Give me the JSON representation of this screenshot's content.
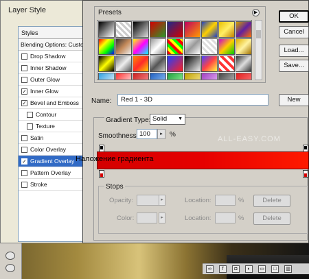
{
  "layer_style": {
    "title": "Layer Style",
    "styles_header": "Styles",
    "blending_options": "Blending Options: Custom",
    "items": [
      {
        "label": "Drop Shadow",
        "checked": false
      },
      {
        "label": "Inner Shadow",
        "checked": false
      },
      {
        "label": "Outer Glow",
        "checked": false
      },
      {
        "label": "Inner Glow",
        "checked": true
      },
      {
        "label": "Bevel and Emboss",
        "checked": true
      },
      {
        "label": "Contour",
        "checked": false
      },
      {
        "label": "Texture",
        "checked": false
      },
      {
        "label": "Satin",
        "checked": false
      },
      {
        "label": "Color Overlay",
        "checked": false
      },
      {
        "label": "Gradient Overlay",
        "checked": true
      },
      {
        "label": "Pattern Overlay",
        "checked": false
      },
      {
        "label": "Stroke",
        "checked": false
      }
    ]
  },
  "gradient_editor": {
    "presets_label": "Presets",
    "buttons": {
      "ok": "OK",
      "cancel": "Cancel",
      "load": "Load...",
      "save": "Save...",
      "new": "New"
    },
    "name_label": "Name:",
    "name_value": "Red 1 - 3D",
    "gradient_type_label": "Gradient Type:",
    "gradient_type_value": "Solid",
    "smoothness_label": "Smoothness:",
    "smoothness_value": "100",
    "smoothness_unit": "%",
    "watermark": "ALL-EASY.COM",
    "stops_label": "Stops",
    "opacity_label": "Opacity:",
    "color_label": "Color:",
    "location_label": "Location:",
    "percent": "%",
    "delete_label": "Delete"
  },
  "overlay_caption": "Наложение градиента",
  "colors": {
    "dialog_bg": "#d4d0c8",
    "selected_row": "#316ac5",
    "gradient_start": "#d40000",
    "gradient_end": "#ff1a00"
  }
}
